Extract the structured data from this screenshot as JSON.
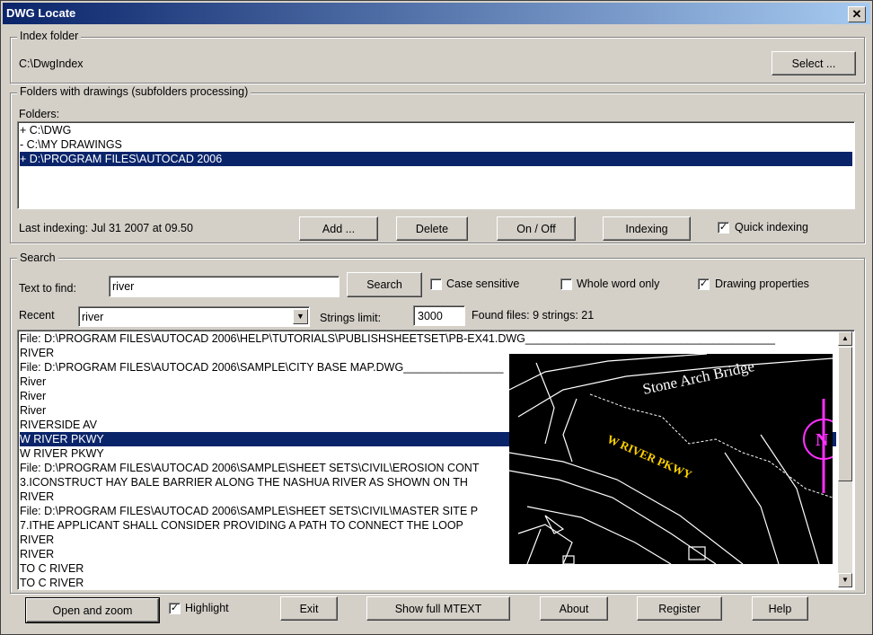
{
  "window": {
    "title": "DWG Locate"
  },
  "index": {
    "group_label": "Index folder",
    "path": "C:\\DwgIndex",
    "select_label": "Select ..."
  },
  "folders": {
    "group_label": "Folders with drawings (subfolders processing)",
    "list_label": "Folders:",
    "items": [
      "+ C:\\DWG",
      "- C:\\MY DRAWINGS",
      "+ D:\\PROGRAM FILES\\AUTOCAD 2006"
    ],
    "selected_index": 2,
    "last_indexing": "Last indexing: Jul 31 2007  at 09.50",
    "add_label": "Add ...",
    "delete_label": "Delete",
    "onoff_label": "On / Off",
    "indexing_label": "Indexing",
    "quick_label": "Quick indexing",
    "quick_checked": true
  },
  "search": {
    "group_label": "Search",
    "text_label": "Text to find:",
    "text_value": "river",
    "search_label": "Search",
    "case_label": "Case sensitive",
    "whole_label": "Whole word only",
    "props_label": "Drawing properties",
    "props_checked": true,
    "recent_label": "Recent",
    "recent_value": "river",
    "limit_label": "Strings limit:",
    "limit_value": "3000",
    "found": "Found files: 9  strings: 21"
  },
  "results": [
    "File: D:\\PROGRAM FILES\\AUTOCAD 2006\\HELP\\TUTORIALS\\PUBLISHSHEETSET\\PB-EX41.DWG________________________________________",
    "    RIVER",
    "File: D:\\PROGRAM FILES\\AUTOCAD 2006\\SAMPLE\\CITY BASE MAP.DWG________________",
    "    River",
    "    River",
    "    River",
    "    RIVERSIDE AV",
    "    W RIVER PKWY",
    "    W RIVER PKWY",
    "File: D:\\PROGRAM FILES\\AUTOCAD 2006\\SAMPLE\\SHEET SETS\\CIVIL\\EROSION CONT",
    "    3.ICONSTRUCT HAY BALE BARRIER ALONG THE NASHUA RIVER AS SHOWN ON TH",
    "    RIVER",
    "File: D:\\PROGRAM FILES\\AUTOCAD 2006\\SAMPLE\\SHEET SETS\\CIVIL\\MASTER SITE P",
    "    7.ITHE APPLICANT SHALL CONSIDER PROVIDING A PATH TO CONNECT THE LOOP",
    "    RIVER",
    "    RIVER",
    "    TO C RIVER",
    "    TO C RIVER"
  ],
  "results_selected_index": 7,
  "preview": {
    "label_bridge": "Stone Arch Bridge",
    "label_pkwy": "W RIVER PKWY",
    "compass_letter": "N"
  },
  "bottom": {
    "open_label": "Open and zoom",
    "highlight_label": "Highlight",
    "highlight_checked": true,
    "exit_label": "Exit",
    "mtext_label": "Show full MTEXT",
    "about_label": "About",
    "register_label": "Register",
    "help_label": "Help"
  },
  "icons": {
    "close": "close-icon",
    "dropdown": "chevron-down-icon",
    "scroll_up": "scroll-up-arrow-icon",
    "scroll_down": "scroll-down-arrow-icon",
    "check": "check-icon"
  }
}
